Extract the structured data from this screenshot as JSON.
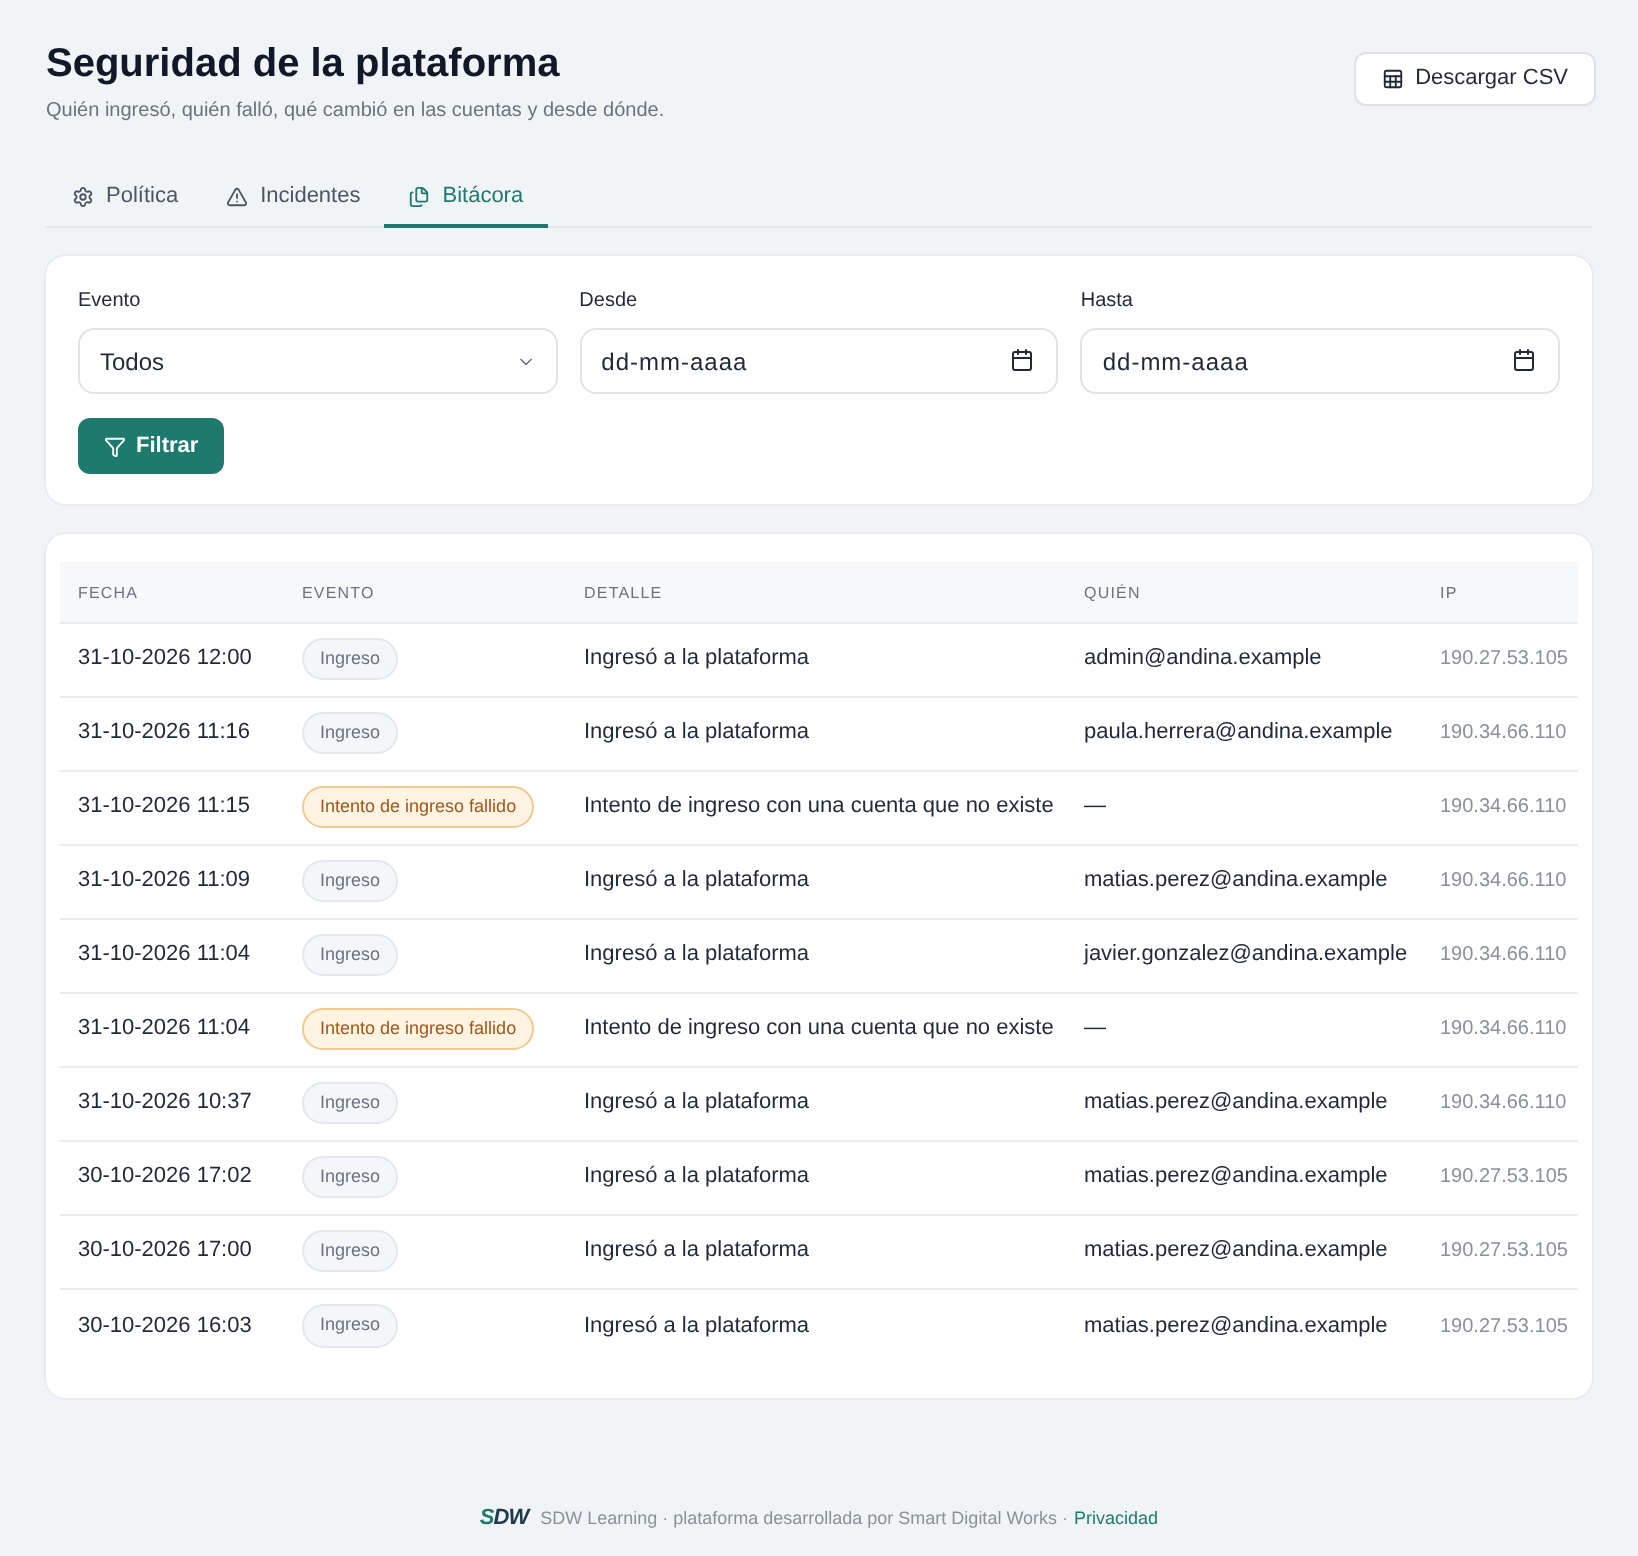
{
  "header": {
    "title": "Seguridad de la plataforma",
    "subtitle": "Quién ingresó, quién falló, qué cambió en las cuentas y desde dónde.",
    "download_button": "Descargar CSV"
  },
  "tabs": [
    {
      "label": "Política",
      "selected": false
    },
    {
      "label": "Incidentes",
      "selected": false
    },
    {
      "label": "Bitácora",
      "selected": true
    }
  ],
  "filters": {
    "fields": [
      {
        "kind": "select",
        "label": "Evento",
        "value": "Todos"
      },
      {
        "kind": "date",
        "label": "Desde",
        "placeholder": "dd-mm-aaaa"
      },
      {
        "kind": "date",
        "label": "Hasta",
        "placeholder": "dd-mm-aaaa"
      }
    ],
    "button": "Filtrar"
  },
  "table": {
    "columns": [
      "FECHA",
      "EVENTO",
      "DETALLE",
      "QUIÉN",
      "IP"
    ],
    "rows": [
      {
        "fecha": "31-10-2026 12:00",
        "evento": {
          "kind": "ok",
          "label": "Ingreso"
        },
        "detalle": "Ingresó a la plataforma",
        "quien": "admin@andina.example",
        "ip": "190.27.53.105"
      },
      {
        "fecha": "31-10-2026 11:16",
        "evento": {
          "kind": "ok",
          "label": "Ingreso"
        },
        "detalle": "Ingresó a la plataforma",
        "quien": "paula.herrera@andina.example",
        "ip": "190.34.66.110"
      },
      {
        "fecha": "31-10-2026 11:15",
        "evento": {
          "kind": "failed",
          "label": "Intento de ingreso fallido"
        },
        "detalle": "Intento de ingreso con una cuenta que no existe",
        "quien": "—",
        "ip": "190.34.66.110"
      },
      {
        "fecha": "31-10-2026 11:09",
        "evento": {
          "kind": "ok",
          "label": "Ingreso"
        },
        "detalle": "Ingresó a la plataforma",
        "quien": "matias.perez@andina.example",
        "ip": "190.34.66.110"
      },
      {
        "fecha": "31-10-2026 11:04",
        "evento": {
          "kind": "ok",
          "label": "Ingreso"
        },
        "detalle": "Ingresó a la plataforma",
        "quien": "javier.gonzalez@andina.example",
        "ip": "190.34.66.110"
      },
      {
        "fecha": "31-10-2026 11:04",
        "evento": {
          "kind": "failed",
          "label": "Intento de ingreso fallido"
        },
        "detalle": "Intento de ingreso con una cuenta que no existe",
        "quien": "—",
        "ip": "190.34.66.110"
      },
      {
        "fecha": "31-10-2026 10:37",
        "evento": {
          "kind": "ok",
          "label": "Ingreso"
        },
        "detalle": "Ingresó a la plataforma",
        "quien": "matias.perez@andina.example",
        "ip": "190.34.66.110"
      },
      {
        "fecha": "30-10-2026 17:02",
        "evento": {
          "kind": "ok",
          "label": "Ingreso"
        },
        "detalle": "Ingresó a la plataforma",
        "quien": "matias.perez@andina.example",
        "ip": "190.27.53.105"
      },
      {
        "fecha": "30-10-2026 17:00",
        "evento": {
          "kind": "ok",
          "label": "Ingreso"
        },
        "detalle": "Ingresó a la plataforma",
        "quien": "matias.perez@andina.example",
        "ip": "190.27.53.105"
      },
      {
        "fecha": "30-10-2026 16:03",
        "evento": {
          "kind": "ok",
          "label": "Ingreso"
        },
        "detalle": "Ingresó a la plataforma",
        "quien": "matias.perez@andina.example",
        "ip": "190.27.53.105"
      }
    ]
  },
  "footer": {
    "logo": "SDW",
    "text": "SDW Learning · plataforma desarrollada por Smart Digital Works ·",
    "link": "Privacidad"
  }
}
